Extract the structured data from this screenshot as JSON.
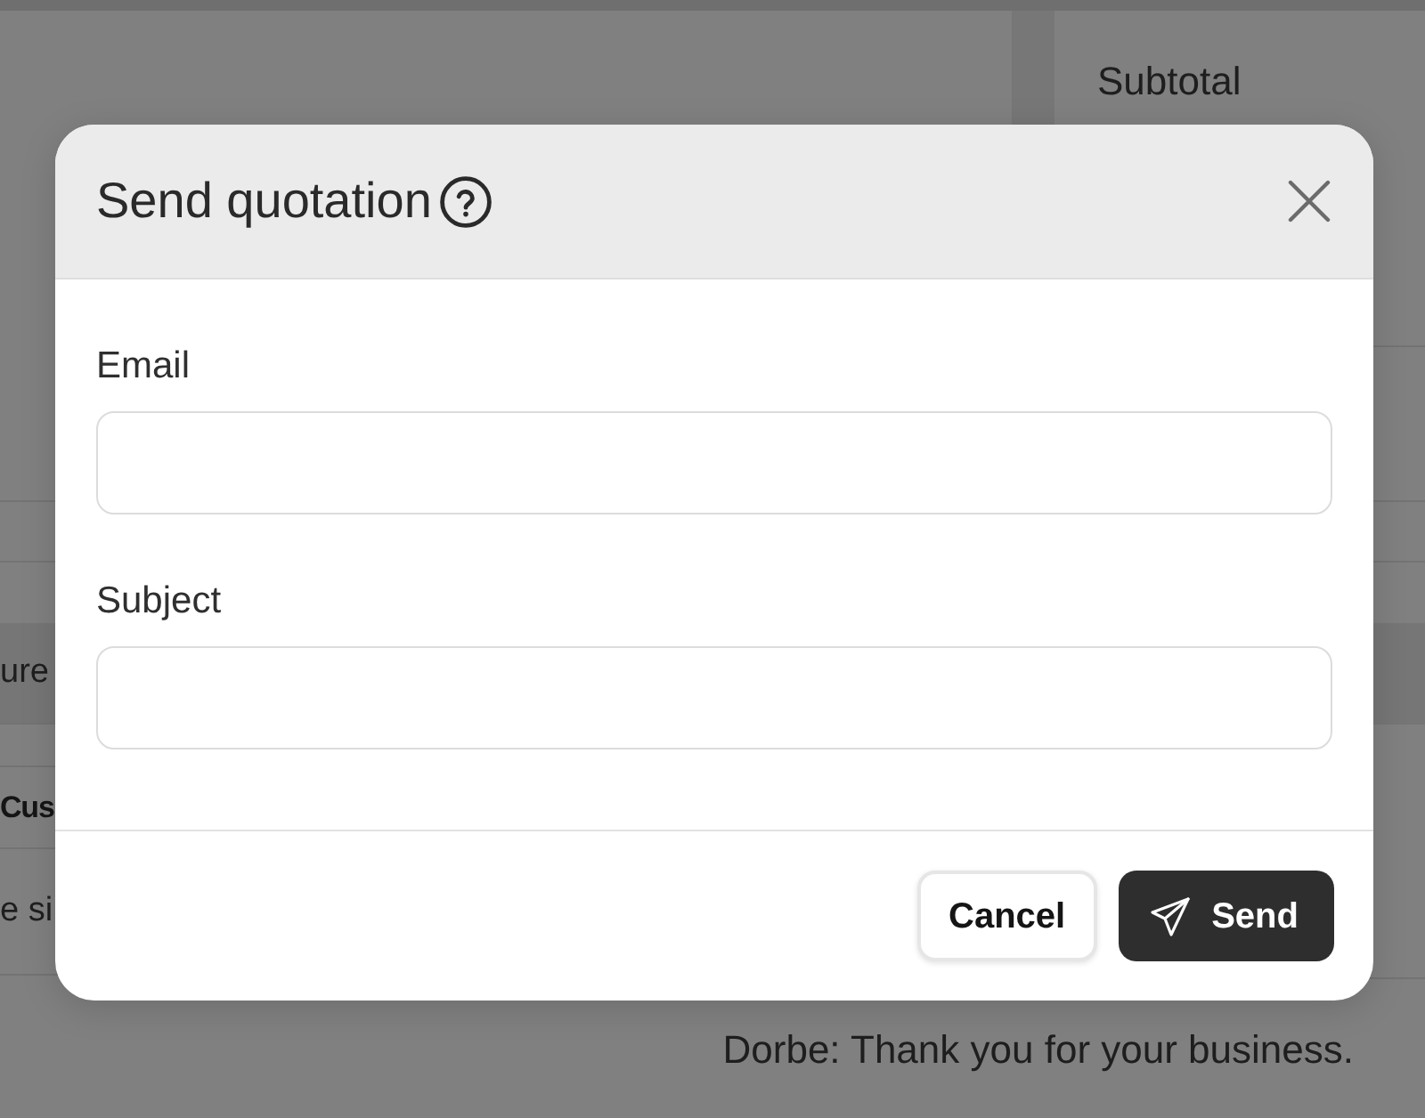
{
  "background_page": {
    "summary_label": "Subtotal",
    "rows": [
      {
        "text": "ure",
        "bold": false,
        "shaded": true
      },
      {
        "text": "Cus",
        "bold": true,
        "shaded": false
      },
      {
        "text": "e si",
        "bold": false,
        "shaded": false
      }
    ],
    "footer_note": "Dorbe: Thank you for your business."
  },
  "dialog": {
    "title": "Send quotation",
    "fields": [
      {
        "label": "Email"
      },
      {
        "label": "Subject"
      }
    ],
    "buttons": [
      {
        "label": "Cancel",
        "kind": "secondary"
      },
      {
        "label": "Send",
        "kind": "primary"
      }
    ]
  }
}
